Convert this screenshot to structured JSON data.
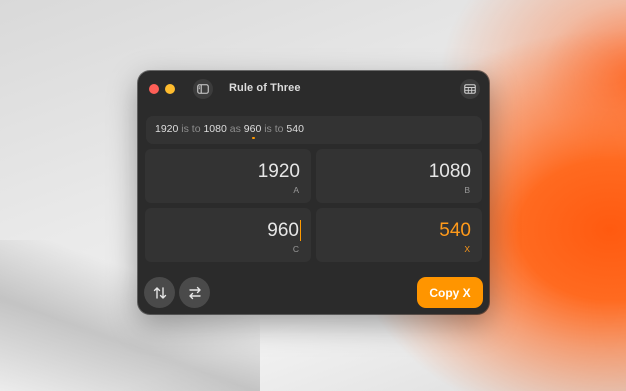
{
  "window": {
    "title": "Rule of Three"
  },
  "sentence": {
    "a": "1920",
    "is_to_1": "is to",
    "b": "1080",
    "as": "as",
    "c": "960",
    "is_to_2": "is to",
    "x": "540"
  },
  "cells": {
    "a": {
      "value": "1920",
      "letter": "A"
    },
    "b": {
      "value": "1080",
      "letter": "B"
    },
    "c": {
      "value": "960",
      "letter": "C"
    },
    "x": {
      "value": "540",
      "letter": "X"
    }
  },
  "actions": {
    "copy_label": "Copy X"
  },
  "icons": {
    "sidebar": "sidebar-toggle-icon",
    "table": "table-icon",
    "swap_vertical": "arrows-up-down-icon",
    "swap_horizontal": "arrows-left-right-icon"
  },
  "colors": {
    "accent": "#ff9500",
    "close": "#fe5f57",
    "minimize": "#febc2e"
  }
}
